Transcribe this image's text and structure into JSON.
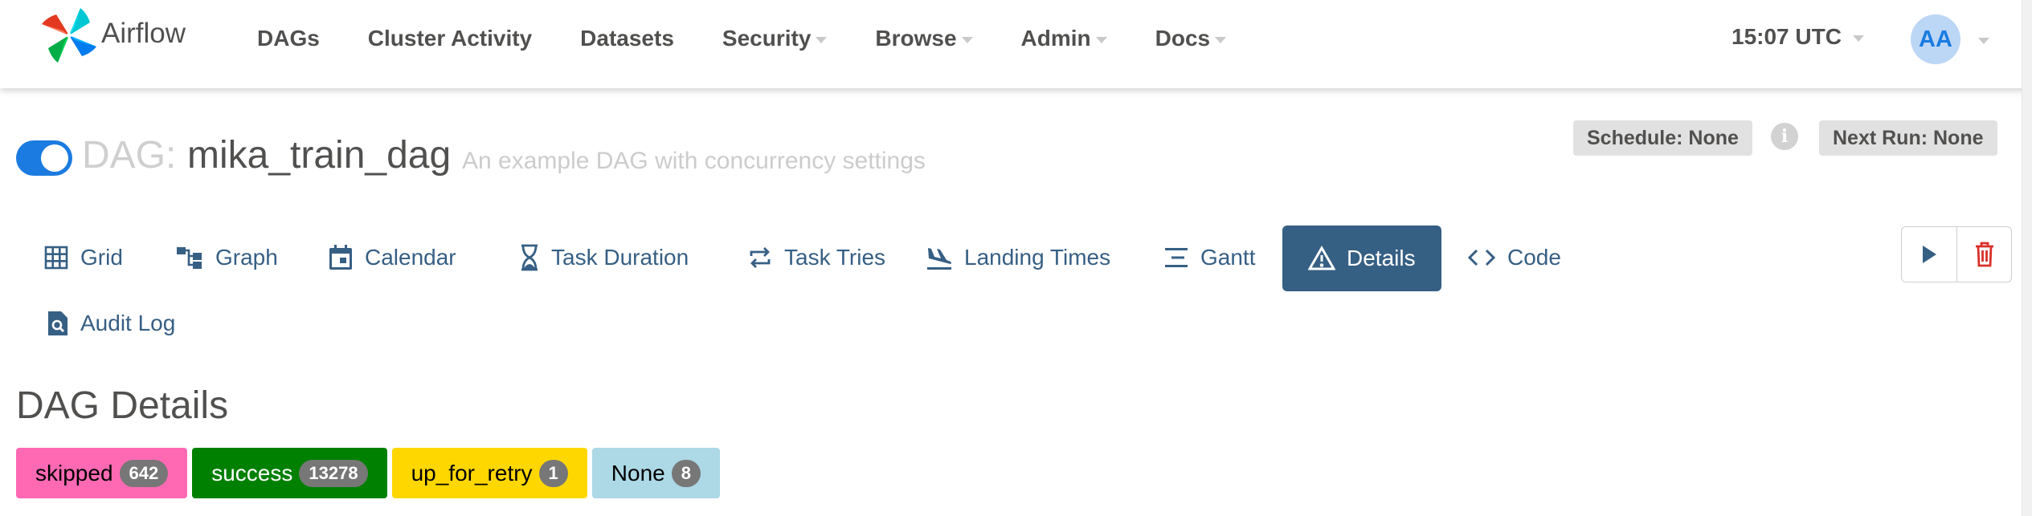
{
  "navbar": {
    "brand": "Airflow",
    "menu": [
      {
        "label": "DAGs",
        "dropdown": false
      },
      {
        "label": "Cluster Activity",
        "dropdown": false
      },
      {
        "label": "Datasets",
        "dropdown": false
      },
      {
        "label": "Security",
        "dropdown": true
      },
      {
        "label": "Browse",
        "dropdown": true
      },
      {
        "label": "Admin",
        "dropdown": true
      },
      {
        "label": "Docs",
        "dropdown": true
      }
    ],
    "clock": "15:07 UTC",
    "user_initials": "AA"
  },
  "dag": {
    "active": true,
    "prefix": "DAG:",
    "name": "mika_train_dag",
    "description": "An example DAG with concurrency settings",
    "schedule": "Schedule: None",
    "next_run": "Next Run: None"
  },
  "tabs": [
    {
      "label": "Grid",
      "icon": "grid-icon"
    },
    {
      "label": "Graph",
      "icon": "graph-icon"
    },
    {
      "label": "Calendar",
      "icon": "calendar-icon"
    },
    {
      "label": "Task Duration",
      "icon": "hourglass-icon"
    },
    {
      "label": "Task Tries",
      "icon": "repeat-icon"
    },
    {
      "label": "Landing Times",
      "icon": "plane-landing-icon"
    },
    {
      "label": "Gantt",
      "icon": "gantt-icon"
    },
    {
      "label": "Details",
      "icon": "warning-triangle-icon",
      "active": true
    },
    {
      "label": "Code",
      "icon": "code-icon"
    },
    {
      "label": "Audit Log",
      "icon": "file-search-icon"
    }
  ],
  "actions": {
    "trigger": "play-icon",
    "delete": "trash-icon"
  },
  "details": {
    "title": "DAG Details",
    "states": [
      {
        "label": "skipped",
        "count": "642",
        "color": "#ff69b4"
      },
      {
        "label": "success",
        "count": "13278",
        "color": "#008000"
      },
      {
        "label": "up_for_retry",
        "count": "1",
        "color": "#ffd700"
      },
      {
        "label": "None",
        "count": "8",
        "color": "#add8e6"
      }
    ]
  },
  "colors": {
    "primary": "#365f84",
    "toggle": "#1b7be0",
    "avatar_bg": "#bcd6f5"
  }
}
